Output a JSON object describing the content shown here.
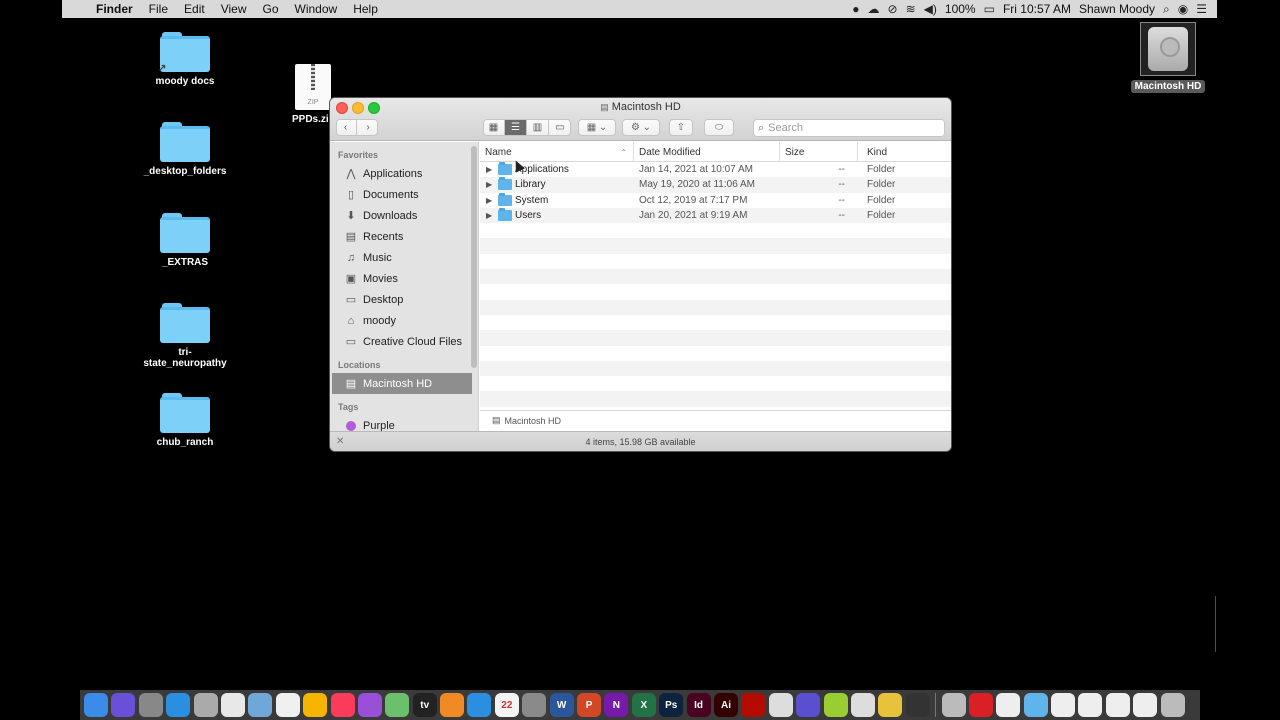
{
  "menubar": {
    "app_name": "Finder",
    "menus": [
      "File",
      "Edit",
      "View",
      "Go",
      "Window",
      "Help"
    ],
    "battery": "100%",
    "clock": "Fri 10:57 AM",
    "user": "Shawn Moody"
  },
  "desktop": {
    "items": [
      {
        "label": "moody docs"
      },
      {
        "label": "_desktop_folders"
      },
      {
        "label": "_EXTRAS"
      },
      {
        "label": "tri-\nstate_neuropathy",
        "line1": "tri-",
        "line2": "state_neuropathy"
      },
      {
        "label": "chub_ranch"
      }
    ],
    "zip": {
      "label": "PPDs.zi",
      "badge": "ZIP"
    },
    "drive": {
      "label": "Macintosh HD"
    }
  },
  "finder": {
    "title": "Macintosh HD",
    "search_placeholder": "Search",
    "sidebar": {
      "favorites_heading": "Favorites",
      "favorites": [
        {
          "label": "Applications",
          "icon": "applications-icon"
        },
        {
          "label": "Documents",
          "icon": "documents-icon"
        },
        {
          "label": "Downloads",
          "icon": "downloads-icon"
        },
        {
          "label": "Recents",
          "icon": "recents-icon"
        },
        {
          "label": "Music",
          "icon": "music-icon"
        },
        {
          "label": "Movies",
          "icon": "movies-icon"
        },
        {
          "label": "Desktop",
          "icon": "desktop-icon"
        },
        {
          "label": "moody",
          "icon": "home-icon"
        },
        {
          "label": "Creative Cloud Files",
          "icon": "folder-icon"
        }
      ],
      "locations_heading": "Locations",
      "locations": [
        {
          "label": "Macintosh HD",
          "icon": "hard-drive-icon",
          "selected": true
        }
      ],
      "tags_heading": "Tags",
      "tags": [
        {
          "label": "Purple",
          "color": "#b45bd9"
        }
      ]
    },
    "columns": {
      "name": "Name",
      "date": "Date Modified",
      "size": "Size",
      "kind": "Kind"
    },
    "rows": [
      {
        "name": "Applications",
        "date": "Jan 14, 2021 at 10:07 AM",
        "size": "--",
        "kind": "Folder"
      },
      {
        "name": "Library",
        "date": "May 19, 2020 at 11:06 AM",
        "size": "--",
        "kind": "Folder"
      },
      {
        "name": "System",
        "date": "Oct 12, 2019 at 7:17 PM",
        "size": "--",
        "kind": "Folder"
      },
      {
        "name": "Users",
        "date": "Jan 20, 2021 at 9:19 AM",
        "size": "--",
        "kind": "Folder"
      }
    ],
    "path": "Macintosh HD",
    "status": "4 items, 15.98 GB available"
  },
  "dock": {
    "apps": [
      {
        "icon": "finder-icon",
        "color": "#3b8ce8",
        "glyph": ""
      },
      {
        "icon": "siri-icon",
        "color": "#6a4fd8",
        "glyph": ""
      },
      {
        "icon": "launchpad-icon",
        "color": "#888",
        "glyph": ""
      },
      {
        "icon": "safari-icon",
        "color": "#2a8fe0",
        "glyph": ""
      },
      {
        "icon": "notes-icon",
        "color": "#aaa",
        "glyph": ""
      },
      {
        "icon": "chrome-icon",
        "color": "#e8e8e8",
        "glyph": ""
      },
      {
        "icon": "preview-icon",
        "color": "#6fa8d8",
        "glyph": ""
      },
      {
        "icon": "news-icon",
        "color": "#f0f0f0",
        "glyph": ""
      },
      {
        "icon": "photos-icon",
        "color": "#f4b400",
        "glyph": ""
      },
      {
        "icon": "music-app-icon",
        "color": "#fa3c5a",
        "glyph": ""
      },
      {
        "icon": "podcasts-icon",
        "color": "#9a4fd8",
        "glyph": ""
      },
      {
        "icon": "maps-icon",
        "color": "#6cc06c",
        "glyph": ""
      },
      {
        "icon": "tv-icon",
        "color": "#222",
        "glyph": "tv"
      },
      {
        "icon": "books-icon",
        "color": "#f08a24",
        "glyph": ""
      },
      {
        "icon": "app-store-icon",
        "color": "#2a8fe0",
        "glyph": ""
      },
      {
        "icon": "calendar-icon",
        "color": "#f4f4f4",
        "glyph": "22"
      },
      {
        "icon": "system-preferences-icon",
        "color": "#8a8a8a",
        "glyph": ""
      },
      {
        "icon": "word-icon",
        "color": "#2b579a",
        "glyph": "W"
      },
      {
        "icon": "powerpoint-icon",
        "color": "#d24726",
        "glyph": "P"
      },
      {
        "icon": "onenote-icon",
        "color": "#7719aa",
        "glyph": "N"
      },
      {
        "icon": "excel-icon",
        "color": "#217346",
        "glyph": "X"
      },
      {
        "icon": "photoshop-icon",
        "color": "#0c2340",
        "glyph": "Ps"
      },
      {
        "icon": "indesign-icon",
        "color": "#49021f",
        "glyph": "Id"
      },
      {
        "icon": "illustrator-icon",
        "color": "#330000",
        "glyph": "Ai"
      },
      {
        "icon": "acrobat-icon",
        "color": "#b30b00",
        "glyph": ""
      },
      {
        "icon": "acrobat-distiller-icon",
        "color": "#ddd",
        "glyph": ""
      },
      {
        "icon": "app-icon",
        "color": "#5a4fcf",
        "glyph": ""
      },
      {
        "icon": "keyboard-icon",
        "color": "#9acd32",
        "glyph": ""
      },
      {
        "icon": "textedit-icon",
        "color": "#ddd",
        "glyph": ""
      },
      {
        "icon": "stickies-icon",
        "color": "#e8c23a",
        "glyph": ""
      },
      {
        "icon": "network-icon",
        "color": "#333",
        "glyph": ""
      }
    ],
    "tray": [
      {
        "icon": "screenshot-icon",
        "color": "#bbb"
      },
      {
        "icon": "creative-cloud-icon",
        "color": "#da1f26"
      },
      {
        "icon": "document-icon",
        "color": "#eee"
      },
      {
        "icon": "downloads-folder-icon",
        "color": "#5fb4ec"
      },
      {
        "icon": "document-icon",
        "color": "#eee"
      },
      {
        "icon": "document-icon",
        "color": "#eee"
      },
      {
        "icon": "document-icon",
        "color": "#eee"
      },
      {
        "icon": "document-icon",
        "color": "#eee"
      },
      {
        "icon": "trash-icon",
        "color": "#bbb"
      }
    ]
  }
}
